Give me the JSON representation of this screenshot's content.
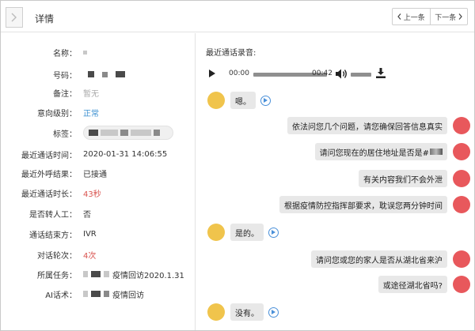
{
  "header": {
    "title": "详情",
    "prev_label": "上一条",
    "next_label": "下一条"
  },
  "details": {
    "name_label": "名称：",
    "phone_label": "号码：",
    "note_label": "备注：",
    "note_value": "暂无",
    "intent_label": "意向级别：",
    "intent_value": "正常",
    "tags_label": "标签：",
    "last_call_time_label": "最近通话时间：",
    "last_call_time_value": "2020-01-31 14:06:55",
    "last_result_label": "最近外呼结果：",
    "last_result_value": "已接通",
    "last_duration_label": "最近通话时长：",
    "last_duration_value": "43秒",
    "transfer_label": "是否转人工：",
    "transfer_value": "否",
    "ended_by_label": "通话结束方：",
    "ended_by_value": "IVR",
    "rounds_label": "对话轮次：",
    "rounds_value": "4次",
    "task_label": "所属任务：",
    "task_value": "疫情回访2020.1.31",
    "script_label": "AI话术：",
    "script_value": "疫情回访"
  },
  "recording": {
    "title": "最近通话录音:",
    "current_time": "00:00",
    "total_time": "00:42"
  },
  "conversation": [
    {
      "speaker": "customer",
      "text": "嗯。"
    },
    {
      "speaker": "robot",
      "text": "依法问您几个问题，请您确保回答信息真实"
    },
    {
      "speaker": "robot",
      "text": "请问您现在的居住地址是否是#"
    },
    {
      "speaker": "robot",
      "text": "有关内容我们不会外泄"
    },
    {
      "speaker": "robot",
      "text": "根据疫情防控指挥部要求，耽误您两分钟时间"
    },
    {
      "speaker": "customer",
      "text": "是的。"
    },
    {
      "speaker": "robot",
      "text": "请问您或您的家人是否从湖北省来沪"
    },
    {
      "speaker": "robot",
      "text": "或途径湖北省吗?"
    },
    {
      "speaker": "customer",
      "text": "没有。"
    }
  ],
  "colors": {
    "customer_avatar": "#f0c44c",
    "robot_avatar": "#e8585c",
    "intent": "#3a8fd0",
    "highlight": "#d9534f"
  }
}
